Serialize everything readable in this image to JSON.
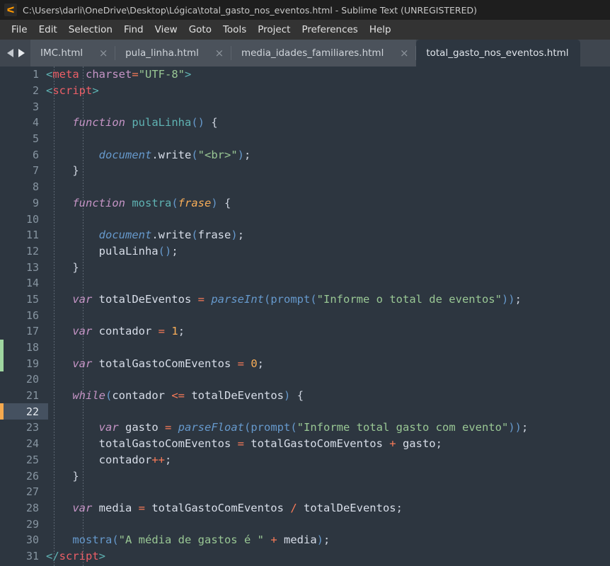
{
  "window": {
    "title": "C:\\Users\\darli\\OneDrive\\Desktop\\Lógica\\total_gasto_nos_eventos.html - Sublime Text (UNREGISTERED)",
    "logo_icon": "sublime-text-logo-icon"
  },
  "menubar": {
    "items": [
      {
        "label": "File"
      },
      {
        "label": "Edit"
      },
      {
        "label": "Selection"
      },
      {
        "label": "Find"
      },
      {
        "label": "View"
      },
      {
        "label": "Goto"
      },
      {
        "label": "Tools"
      },
      {
        "label": "Project"
      },
      {
        "label": "Preferences"
      },
      {
        "label": "Help"
      }
    ]
  },
  "tabbar": {
    "prev_icon": "arrow-left-icon",
    "next_icon": "arrow-right-icon",
    "close_icon": "×",
    "tabs": [
      {
        "label": "IMC.html",
        "active": false
      },
      {
        "label": "pula_linha.html",
        "active": false
      },
      {
        "label": "media_idades_familiares.html",
        "active": false
      },
      {
        "label": "total_gasto_nos_eventos.html",
        "active": true
      }
    ]
  },
  "editor": {
    "caret_line": 22,
    "colors": {
      "background": "#2d3640",
      "gutter_highlight": "#455160",
      "marker_added": "#9fd6a0",
      "marker_modified": "#f5a94e",
      "string": "#99c794",
      "keyword": "#c594c5",
      "function": "#6699cc",
      "number": "#f9ae58",
      "operator": "#f97b58",
      "tag": "#ec5f67"
    },
    "lines": [
      {
        "n": 1,
        "marker": "none",
        "tokens": [
          [
            "t-tagbracket",
            "<"
          ],
          [
            "t-tagname",
            "meta"
          ],
          [
            "t-plain",
            " "
          ],
          [
            "t-attr",
            "charset"
          ],
          [
            "t-op",
            "="
          ],
          [
            "t-str",
            "\"UTF-8\""
          ],
          [
            "t-tagbracket",
            ">"
          ]
        ]
      },
      {
        "n": 2,
        "marker": "none",
        "tokens": [
          [
            "t-tagbracket",
            "<"
          ],
          [
            "t-tagname",
            "script"
          ],
          [
            "t-tagbracket",
            ">"
          ]
        ]
      },
      {
        "n": 3,
        "marker": "none",
        "tokens": []
      },
      {
        "n": 4,
        "marker": "none",
        "tokens": [
          [
            "t-plain",
            "    "
          ],
          [
            "t-kw",
            "function"
          ],
          [
            "t-plain",
            " "
          ],
          [
            "t-def",
            "pulaLinha"
          ],
          [
            "t-fncall",
            "()"
          ],
          [
            "t-plain",
            " "
          ],
          [
            "t-punct",
            "{"
          ]
        ]
      },
      {
        "n": 5,
        "marker": "none",
        "tokens": []
      },
      {
        "n": 6,
        "marker": "none",
        "tokens": [
          [
            "t-plain",
            "        "
          ],
          [
            "t-fn",
            "document"
          ],
          [
            "t-punct",
            "."
          ],
          [
            "t-plain",
            "write"
          ],
          [
            "t-fncall",
            "("
          ],
          [
            "t-str",
            "\"<br>\""
          ],
          [
            "t-fncall",
            ")"
          ],
          [
            "t-punct",
            ";"
          ]
        ]
      },
      {
        "n": 7,
        "marker": "none",
        "tokens": [
          [
            "t-plain",
            "    "
          ],
          [
            "t-punct",
            "}"
          ]
        ]
      },
      {
        "n": 8,
        "marker": "none",
        "tokens": []
      },
      {
        "n": 9,
        "marker": "none",
        "tokens": [
          [
            "t-plain",
            "    "
          ],
          [
            "t-kw",
            "function"
          ],
          [
            "t-plain",
            " "
          ],
          [
            "t-def",
            "mostra"
          ],
          [
            "t-fncall",
            "("
          ],
          [
            "t-param",
            "frase"
          ],
          [
            "t-fncall",
            ")"
          ],
          [
            "t-plain",
            " "
          ],
          [
            "t-punct",
            "{"
          ]
        ]
      },
      {
        "n": 10,
        "marker": "none",
        "tokens": []
      },
      {
        "n": 11,
        "marker": "none",
        "tokens": [
          [
            "t-plain",
            "        "
          ],
          [
            "t-fn",
            "document"
          ],
          [
            "t-punct",
            "."
          ],
          [
            "t-plain",
            "write"
          ],
          [
            "t-fncall",
            "("
          ],
          [
            "t-plain",
            "frase"
          ],
          [
            "t-fncall",
            ")"
          ],
          [
            "t-punct",
            ";"
          ]
        ]
      },
      {
        "n": 12,
        "marker": "none",
        "tokens": [
          [
            "t-plain",
            "        "
          ],
          [
            "t-plain",
            "pulaLinha"
          ],
          [
            "t-fncall",
            "()"
          ],
          [
            "t-punct",
            ";"
          ]
        ]
      },
      {
        "n": 13,
        "marker": "none",
        "tokens": [
          [
            "t-plain",
            "    "
          ],
          [
            "t-punct",
            "}"
          ]
        ]
      },
      {
        "n": 14,
        "marker": "none",
        "tokens": []
      },
      {
        "n": 15,
        "marker": "none",
        "tokens": [
          [
            "t-plain",
            "    "
          ],
          [
            "t-kw",
            "var"
          ],
          [
            "t-plain",
            " totalDeEventos "
          ],
          [
            "t-op",
            "="
          ],
          [
            "t-plain",
            " "
          ],
          [
            "t-fn",
            "parseInt"
          ],
          [
            "t-fncall",
            "("
          ],
          [
            "t-fncall",
            "prompt"
          ],
          [
            "t-fncall",
            "("
          ],
          [
            "t-str",
            "\"Informe o total de eventos\""
          ],
          [
            "t-fncall",
            "))"
          ],
          [
            "t-punct",
            ";"
          ]
        ]
      },
      {
        "n": 16,
        "marker": "none",
        "tokens": []
      },
      {
        "n": 17,
        "marker": "none",
        "tokens": [
          [
            "t-plain",
            "    "
          ],
          [
            "t-kw",
            "var"
          ],
          [
            "t-plain",
            " contador "
          ],
          [
            "t-op",
            "="
          ],
          [
            "t-plain",
            " "
          ],
          [
            "t-num",
            "1"
          ],
          [
            "t-punct",
            ";"
          ]
        ]
      },
      {
        "n": 18,
        "marker": "added",
        "tokens": []
      },
      {
        "n": 19,
        "marker": "added",
        "tokens": [
          [
            "t-plain",
            "    "
          ],
          [
            "t-kw",
            "var"
          ],
          [
            "t-plain",
            " totalGastoComEventos "
          ],
          [
            "t-op",
            "="
          ],
          [
            "t-plain",
            " "
          ],
          [
            "t-num",
            "0"
          ],
          [
            "t-punct",
            ";"
          ]
        ]
      },
      {
        "n": 20,
        "marker": "none",
        "tokens": []
      },
      {
        "n": 21,
        "marker": "none",
        "tokens": [
          [
            "t-plain",
            "    "
          ],
          [
            "t-kw",
            "while"
          ],
          [
            "t-fncall",
            "("
          ],
          [
            "t-plain",
            "contador "
          ],
          [
            "t-op",
            "<="
          ],
          [
            "t-plain",
            " totalDeEventos"
          ],
          [
            "t-fncall",
            ")"
          ],
          [
            "t-plain",
            " "
          ],
          [
            "t-punct",
            "{"
          ]
        ]
      },
      {
        "n": 22,
        "marker": "modified",
        "tokens": []
      },
      {
        "n": 23,
        "marker": "none",
        "tokens": [
          [
            "t-plain",
            "        "
          ],
          [
            "t-kw",
            "var"
          ],
          [
            "t-plain",
            " gasto "
          ],
          [
            "t-op",
            "="
          ],
          [
            "t-plain",
            " "
          ],
          [
            "t-fn",
            "parseFloat"
          ],
          [
            "t-fncall",
            "("
          ],
          [
            "t-fncall",
            "prompt"
          ],
          [
            "t-fncall",
            "("
          ],
          [
            "t-str",
            "\"Informe total gasto com evento\""
          ],
          [
            "t-fncall",
            "))"
          ],
          [
            "t-punct",
            ";"
          ]
        ]
      },
      {
        "n": 24,
        "marker": "none",
        "tokens": [
          [
            "t-plain",
            "        totalGastoComEventos "
          ],
          [
            "t-op",
            "="
          ],
          [
            "t-plain",
            " totalGastoComEventos "
          ],
          [
            "t-op",
            "+"
          ],
          [
            "t-plain",
            " gasto"
          ],
          [
            "t-punct",
            ";"
          ]
        ]
      },
      {
        "n": 25,
        "marker": "none",
        "tokens": [
          [
            "t-plain",
            "        contador"
          ],
          [
            "t-op",
            "++"
          ],
          [
            "t-punct",
            ";"
          ]
        ]
      },
      {
        "n": 26,
        "marker": "none",
        "tokens": [
          [
            "t-plain",
            "    "
          ],
          [
            "t-punct",
            "}"
          ]
        ]
      },
      {
        "n": 27,
        "marker": "none",
        "tokens": []
      },
      {
        "n": 28,
        "marker": "none",
        "tokens": [
          [
            "t-plain",
            "    "
          ],
          [
            "t-kw",
            "var"
          ],
          [
            "t-plain",
            " media "
          ],
          [
            "t-op",
            "="
          ],
          [
            "t-plain",
            " totalGastoComEventos "
          ],
          [
            "t-op",
            "/"
          ],
          [
            "t-plain",
            " totalDeEventos"
          ],
          [
            "t-punct",
            ";"
          ]
        ]
      },
      {
        "n": 29,
        "marker": "none",
        "tokens": []
      },
      {
        "n": 30,
        "marker": "none",
        "tokens": [
          [
            "t-plain",
            "    "
          ],
          [
            "t-fncall",
            "mostra"
          ],
          [
            "t-fncall",
            "("
          ],
          [
            "t-str",
            "\"A média de gastos é \""
          ],
          [
            "t-plain",
            " "
          ],
          [
            "t-op",
            "+"
          ],
          [
            "t-plain",
            " media"
          ],
          [
            "t-fncall",
            ")"
          ],
          [
            "t-punct",
            ";"
          ]
        ]
      },
      {
        "n": 31,
        "marker": "none",
        "tokens": [
          [
            "t-tagbracket",
            "</"
          ],
          [
            "t-tagname",
            "script"
          ],
          [
            "t-tagbracket",
            ">"
          ]
        ]
      }
    ]
  }
}
